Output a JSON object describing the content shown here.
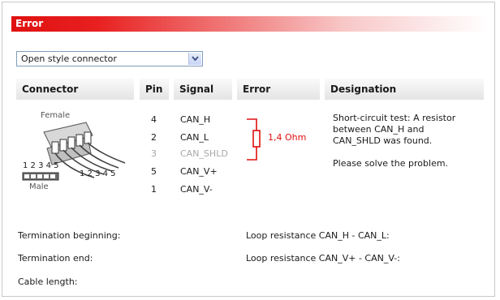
{
  "dialog": {
    "title": "Error"
  },
  "connector_select": {
    "value": "Open style connector"
  },
  "table": {
    "headers": {
      "connector": "Connector",
      "pin": "Pin",
      "signal": "Signal",
      "error": "Error",
      "designation": "Designation"
    },
    "connector_labels": {
      "female": "Female",
      "male": "Male",
      "pins_top": "1 2 3 4 5",
      "pins_bottom": "1 2 3 4 5"
    },
    "pins": [
      "4",
      "2",
      "3",
      "5",
      "1"
    ],
    "signals": [
      "CAN_H",
      "CAN_L",
      "CAN_SHLD",
      "CAN_V+",
      "CAN_V-"
    ],
    "error_value": "1,4 Ohm",
    "designation_lines": [
      "Short-circuit test: A resistor",
      "between CAN_H and",
      "CAN_SHLD was found.",
      "",
      "Please solve the problem."
    ]
  },
  "results": {
    "termination_beginning": "Termination beginning:",
    "termination_end": "Termination end:",
    "cable_length": "Cable length:",
    "loop_h_l": "Loop resistance CAN_H - CAN_L:",
    "loop_v": "Loop resistance CAN_V+ - CAN_V-:"
  },
  "colors": {
    "error_red": "#e01010",
    "disabled_gray": "#a8a8a8"
  }
}
